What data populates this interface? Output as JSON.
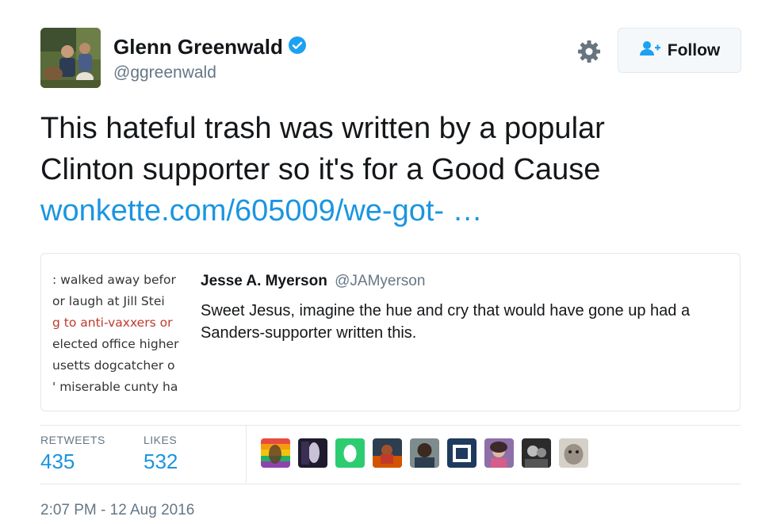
{
  "author": {
    "name": "Glenn Greenwald",
    "handle": "@ggreenwald",
    "verified_icon": "verified-badge-icon",
    "avatar_icon": "profile-photo"
  },
  "actions": {
    "settings_icon": "gear-icon",
    "follow_label": "Follow",
    "follow_icon": "add-user-icon"
  },
  "tweet": {
    "line1": "This hateful trash was written by a popular",
    "line2": "Clinton supporter so it's for a Good Cause",
    "link": "wonkette.com/605009/we-got-  …"
  },
  "quote": {
    "media_lines": [
      ": walked away befor",
      " or laugh at Jill Stei",
      "g to anti-vaxxers or",
      "elected office higher",
      "usetts dogcatcher o",
      "' miserable cunty ha"
    ],
    "name": "Jesse A. Myerson",
    "handle": "@JAMyerson",
    "text": "Sweet Jesus, imagine the hue and cry that would have gone up had a Sanders-supporter written this."
  },
  "stats": {
    "retweets_label": "RETWEETS",
    "retweets_value": "435",
    "likes_label": "LIKES",
    "likes_value": "532"
  },
  "timestamp": "2:07 PM - 12 Aug 2016",
  "colors": {
    "link": "#1b95e0",
    "muted": "#657786",
    "border": "#e1e8ed"
  }
}
